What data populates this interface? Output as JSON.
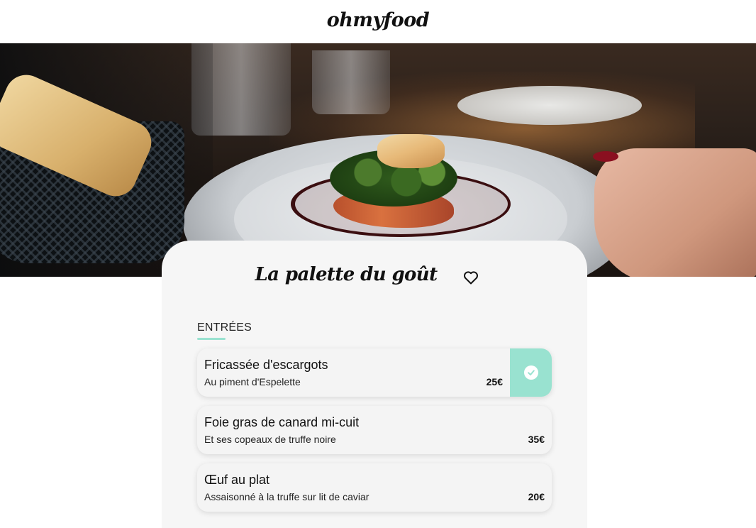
{
  "header": {
    "logo": "ohmyfood"
  },
  "hero": {
    "image_alt": "restaurant-dish-photo"
  },
  "restaurant": {
    "name": "La palette du goût",
    "favorite_icon": "heart-icon",
    "favorited": false
  },
  "menu": {
    "section_title": "ENTRÉES",
    "accent_color": "#99e2d0",
    "dishes": [
      {
        "name": "Fricassée d'escargots",
        "description": "Au piment d'Espelette",
        "price": "25€",
        "selected": true,
        "check_icon": "check-icon"
      },
      {
        "name": "Foie gras de canard mi-cuit",
        "description": "Et ses copeaux de truffe noire",
        "price": "35€",
        "selected": false
      },
      {
        "name": "Œuf au plat",
        "description": "Assaisonné à la truffe sur lit de caviar",
        "price": "20€",
        "selected": false
      }
    ]
  }
}
